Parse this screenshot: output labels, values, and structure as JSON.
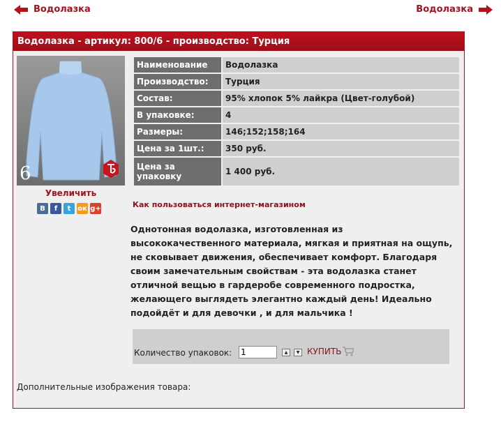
{
  "nav": {
    "prev": "Водолазка",
    "next": "Водолазка"
  },
  "header": {
    "title": "Водолазка - артикул: 800/6 - производство: Турция"
  },
  "photo": {
    "number": "6"
  },
  "enlarge": "Увеличить",
  "social": [
    {
      "label": "В",
      "icon": "vkontakte-icon",
      "color": "#4a6c95"
    },
    {
      "label": "f",
      "icon": "facebook-icon",
      "color": "#3b5998"
    },
    {
      "label": "t",
      "icon": "twitter-icon",
      "color": "#3aa3dc"
    },
    {
      "label": "ок",
      "icon": "odnoklassniki-icon",
      "color": "#f39a1f"
    },
    {
      "label": "g+",
      "icon": "googleplus-icon",
      "color": "#d9412b"
    }
  ],
  "specs": [
    {
      "key": "Наименование",
      "value": "Водолазка"
    },
    {
      "key": "Производство:",
      "value": "Турция"
    },
    {
      "key": "Состав:",
      "value": "95% хлопок 5% лайкра (Цвет-голубой)"
    },
    {
      "key": "В упаковке:",
      "value": "4"
    },
    {
      "key": "Размеры:",
      "value": "146;152;158;164"
    },
    {
      "key": "Цена за 1шт.:",
      "value": "350 руб."
    },
    {
      "key": "Цена за упаковку",
      "value": "1 400 руб."
    }
  ],
  "howto": "Как пользоваться интернет-магазином",
  "description": "Однотонная водолазка, изготовленная из высококачественного материала, мягкая и приятная на ощупь, не сковывает движения, обеспечивает комфорт. Благодаря своим замечательным свойствам - эта водолазка станет отличной вещью в гардеробе современного подростка, желающего выглядеть элегантно каждый день! Идеально подойдёт и для девочки , и для мальчика !",
  "buy": {
    "label": "Количество упаковок:",
    "quantity": "1",
    "button": "КУПИТЬ"
  },
  "more_images": "Дополнительные изображения товара:"
}
